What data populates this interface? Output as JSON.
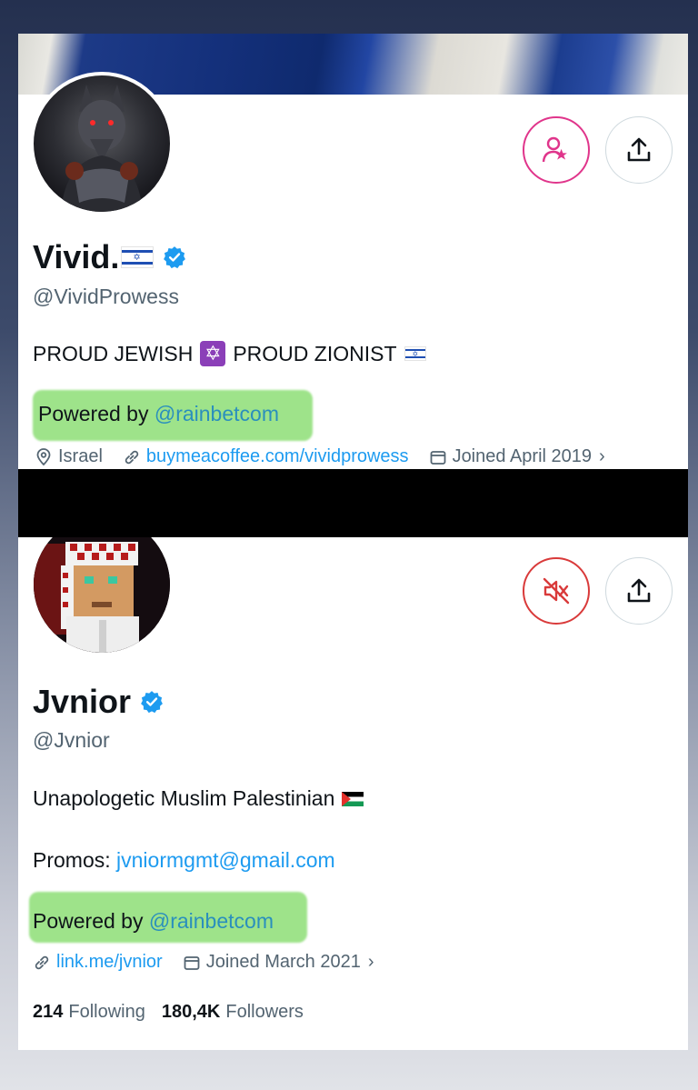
{
  "profile1": {
    "display_name": "Vivid.",
    "handle": "@VividProwess",
    "bio_part1": "PROUD JEWISH",
    "bio_part2": "PROUD ZIONIST",
    "powered_prefix": "Powered by ",
    "powered_link": "@rainbetcom",
    "location": "Israel",
    "website": "buymeacoffee.com/vividprowess",
    "joined": "Joined April 2019",
    "flag_symbol": "✡",
    "star_symbol": "✡"
  },
  "profile2": {
    "display_name": "Jvnior",
    "handle": "@Jvnior",
    "bio": "Unapologetic Muslim Palestinian",
    "promos_label": "Promos: ",
    "promos_email": "jvniormgmt@gmail.com",
    "powered_prefix": "Powered by ",
    "powered_link": "@rainbetcom",
    "website": "link.me/jvnior",
    "joined": "Joined March 2021",
    "following_count": "214",
    "following_label": "Following",
    "followers_count": "180,4K",
    "followers_label": "Followers"
  },
  "ui": {
    "chevron": "›"
  },
  "colors": {
    "verified_blue": "#1d9bf0",
    "highlight_green": "#9ee38a",
    "notify_pink": "#e0358b",
    "mute_red": "#d93a3a"
  },
  "icons": [
    "verified-badge-icon",
    "notify-person-icon",
    "share-icon",
    "mute-speaker-icon",
    "location-pin-icon",
    "link-icon",
    "calendar-icon"
  ]
}
